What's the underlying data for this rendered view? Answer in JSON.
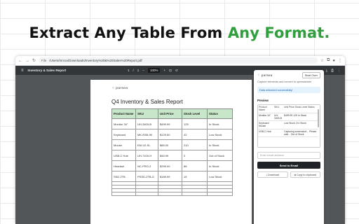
{
  "headline": {
    "part1": "Extract Any Table From",
    "part2": "Any Format."
  },
  "browser": {
    "nav_icons": {
      "back": "←",
      "forward": "→",
      "reload": "↻"
    },
    "file_label": "File",
    "url": "/Users/mrcoo/Downloads/Inventory%20&%20Sales%20Report.pdf",
    "extension_icons": {
      "star": "☆",
      "puzzle": "⧉",
      "profile": "●",
      "menu": "⋮"
    }
  },
  "pdf": {
    "menu_icon": "≡",
    "title": "Inventory & Sales Report",
    "page_current": "1",
    "page_separator": "/",
    "page_total": "1",
    "zoom_minus": "−",
    "zoom": "100%",
    "zoom_plus": "+",
    "fit_icon": "⊡",
    "rotate_icon": "↺",
    "download_icon": "⤓",
    "print_icon": "⎙",
    "more_icon": "⋮",
    "logo_mark": "⁘",
    "logo_text": "parsea",
    "report_title": "Q4 Inventory & Sales Report",
    "columns": [
      "Product Name",
      "SKU",
      "Unit Price",
      "Stock Level",
      "Status"
    ],
    "rows": [
      [
        "Monitor 34\"",
        "UH-3400-B",
        "$499.99",
        "125",
        "In Stock"
      ],
      [
        "Keyboard",
        "MK-R3B-99",
        "$129.50",
        "42",
        "Low Stock"
      ],
      [
        "Mouse",
        "EM-V2-SL",
        "$85.00",
        "210",
        "In Stock"
      ],
      [
        "USB-C Hub",
        "UH-7100-H",
        "$45.99",
        "0",
        "Out of Stock"
      ],
      [
        "Headset",
        "NC-PRO-2",
        "$299.00",
        "88",
        "In Stock"
      ],
      [
        "SSD 2TB",
        "PSSD-2TB-G",
        "$189.99",
        "15",
        "Low Stock"
      ]
    ]
  },
  "panel": {
    "logo_mark": "⁘",
    "logo_text": "parsea",
    "start_over": "Start Over",
    "subtitle": "Capture elements and convert to spreadsheet",
    "success": "Data extracted successfully!",
    "preview_label": "Preview",
    "preview_rows": [
      [
        "Product Name",
        "SKU",
        "Unit Price Stock Level Status"
      ],
      [
        "Monitor 34\"",
        "UH-3400-B",
        "$499.99 125 In Stock"
      ],
      [
        "Keyboard Mouse",
        "",
        "Low Stock 2 In Stock"
      ],
      [
        "USB-C Hub",
        "",
        "Capturing screenshot... Please wait... Out of Stock"
      ]
    ],
    "email_placeholder": "Enter email address",
    "send_email": "Send to Email",
    "download_icon": "⤓",
    "download": "Download",
    "copy_icon": "⧉",
    "copy": "Copy to clipboard"
  }
}
